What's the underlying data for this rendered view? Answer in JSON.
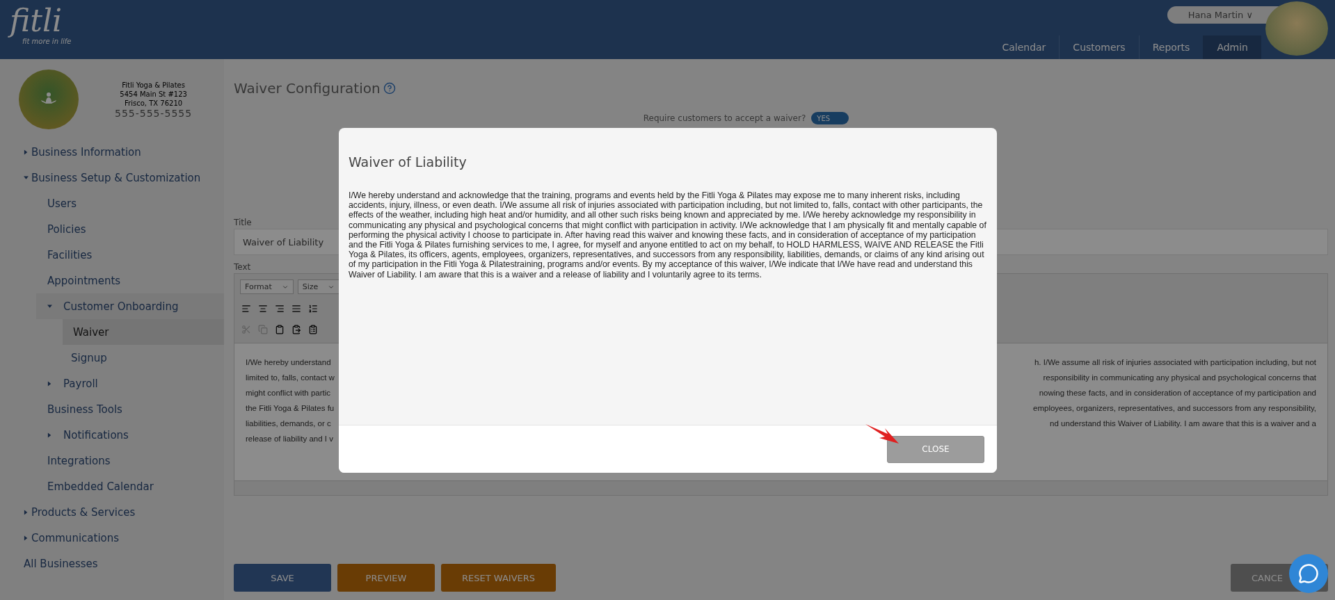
{
  "header": {
    "logo": {
      "name": "fitli",
      "tagline": "fit more in life"
    },
    "user": {
      "name": "Hana Martin",
      "caret": "∨"
    },
    "nav": [
      {
        "label": "Calendar",
        "selected": false
      },
      {
        "label": "Customers",
        "selected": false
      },
      {
        "label": "Reports",
        "selected": false
      },
      {
        "label": "Admin",
        "selected": true
      }
    ]
  },
  "business": {
    "name": "Fitli Yoga & Pilates",
    "address_lines": [
      "5454 Main St #123",
      "Frisco, TX 76210"
    ],
    "phone": "555-555-5555"
  },
  "sidebar": {
    "items": [
      {
        "label": "Business Information",
        "kind": "group",
        "expanded": false,
        "selected": false
      },
      {
        "label": "Business Setup & Customization",
        "kind": "group",
        "expanded": true,
        "selected": false,
        "children": [
          {
            "label": "Users",
            "kind": "link",
            "selected": false
          },
          {
            "label": "Policies",
            "kind": "link",
            "selected": false
          },
          {
            "label": "Facilities",
            "kind": "link",
            "selected": false
          },
          {
            "label": "Appointments",
            "kind": "link",
            "selected": false
          },
          {
            "label": "Customer Onboarding",
            "kind": "group",
            "expanded": true,
            "selected": false,
            "children": [
              {
                "label": "Waiver",
                "kind": "link",
                "selected": true
              },
              {
                "label": "Signup",
                "kind": "link",
                "selected": false
              }
            ]
          },
          {
            "label": "Payroll",
            "kind": "group",
            "expanded": false,
            "selected": false
          },
          {
            "label": "Business Tools",
            "kind": "link",
            "selected": false
          },
          {
            "label": "Notifications",
            "kind": "group",
            "expanded": false,
            "selected": false
          },
          {
            "label": "Integrations",
            "kind": "link",
            "selected": false
          },
          {
            "label": "Embedded Calendar",
            "kind": "link",
            "selected": false
          }
        ]
      },
      {
        "label": "Products & Services",
        "kind": "group",
        "expanded": false,
        "selected": false
      },
      {
        "label": "Communications",
        "kind": "group",
        "expanded": false,
        "selected": false
      },
      {
        "label": "All Businesses",
        "kind": "link",
        "selected": false
      }
    ]
  },
  "page": {
    "title": "Waiver Configuration",
    "require": {
      "label": "Require customers to accept a waiver?",
      "on": true,
      "on_label": "YES"
    },
    "title_field": {
      "label": "Title",
      "value": "Waiver of Liability"
    },
    "text_field": {
      "label": "Text",
      "format": "Format",
      "size": "Size",
      "lines": [
        {
          "left": "I/We hereby understand",
          "right": "h. I/We assume all risk of injuries associated with participation including, but not"
        },
        {
          "left": "limited to, falls, contact w",
          "right": "responsibility in communicating any physical and psychological concerns that"
        },
        {
          "left": "might conflict with partic",
          "right": "nowing these facts, and in consideration of acceptance of my participation and"
        },
        {
          "left": "the Fitli Yoga & Pilates fu",
          "right": "employees, organizers, representatives, and successors from any responsibility,"
        },
        {
          "left": "liabilities, demands, or c",
          "right": "nd understand this Waiver of Liability. I am aware that this is a waiver and a"
        },
        {
          "left": "release of liability and I v"
        }
      ]
    },
    "buttons": [
      {
        "label": "SAVE",
        "kind": "primary"
      },
      {
        "label": "PREVIEW",
        "kind": "warning"
      },
      {
        "label": "RESET WAIVERS",
        "kind": "warning"
      },
      {
        "label": "CANCE",
        "kind": "default"
      }
    ]
  },
  "modal": {
    "title": "Waiver of Liability",
    "body": "I/We hereby understand and acknowledge that the training, programs and events held by the Fitli Yoga & Pilates may expose me to many inherent risks, including accidents, injury, illness, or even death. I/We assume all risk of injuries associated with participation including, but not limited to, falls, contact with other participants, the effects of the weather, including high heat and/or humidity, and all other such risks being known and appreciated by me. I/We hereby acknowledge my responsibility in communicating any physical and psychological concerns that might conflict with participation in activity. I/We acknowledge that I am physically fit and mentally capable of performing the physical activity I choose to participate in. After having read this waiver and knowing these facts, and in consideration of acceptance of my participation and the Fitli Yoga & Pilates furnishing services to me, I agree, for myself and anyone entitled to act on my behalf, to HOLD HARMLESS, WAIVE AND RELEASE the Fitli Yoga & Pilates, its officers, agents, employees, organizers, representatives, and successors from any responsibility, liabilities, demands, or claims of any kind arising out of my participation in the Fitli Yoga & Pilatestraining, programs and/or events. By my acceptance of this waiver, I/We indicate that I/We have read and understand this Waiver of Liability. I am aware that this is a waiver and a release of liability and I voluntarily agree to its terms.",
    "close": "CLOSE"
  }
}
